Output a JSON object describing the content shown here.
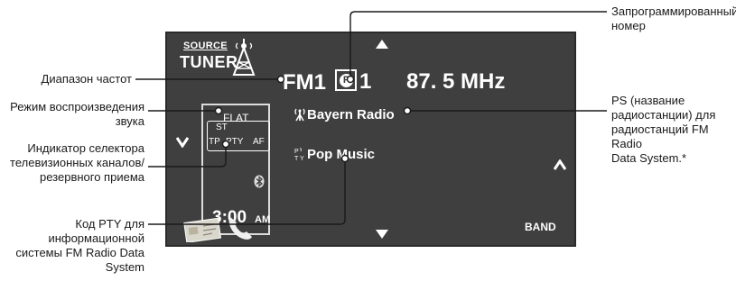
{
  "screen": {
    "source_label": "SOURCE",
    "tuner_label": "TUNER",
    "band": "FM1",
    "preset_badge": "P",
    "preset_number": "1",
    "frequency": "87. 5 MHz",
    "station_name": "Bayern Radio",
    "pty_name": "Pop Music",
    "sound_mode": "FLAT",
    "st_indicator": "ST",
    "tp_indicator": "TP",
    "pty_indicator": "PTY",
    "af_indicator": "AF",
    "clock_time": "3:00",
    "clock_ampm": "AM",
    "band_button": "BAND"
  },
  "callouts": {
    "preset_number": [
      "Запрограммированный",
      "номер"
    ],
    "frequency_band": [
      "Диапазон частот"
    ],
    "sound_mode": [
      "Режим воспроизведения",
      "звука"
    ],
    "tp_pty_indicator": [
      "Индикатор селектора",
      "телевизионных каналов/",
      "резервного приема"
    ],
    "pty_code": [
      "Код PTY для",
      "информационной",
      "системы FM Radio Data",
      "System"
    ],
    "ps_name": [
      "PS (название",
      "радиостанции) для",
      "радиостанций FM Radio",
      "Data System.*"
    ]
  },
  "colors": {
    "screen_bg": "#3f3f3f",
    "display_text": "#ffffff",
    "callout_line": "#1a1a1a"
  },
  "icons": [
    "antenna-tower-icon",
    "arrow-up-icon",
    "arrow-down-icon",
    "chevron-left-icon",
    "chevron-right-icon",
    "bluetooth-icon",
    "phone-handset-icon",
    "card-icon",
    "signal-icon",
    "pty-icon"
  ]
}
